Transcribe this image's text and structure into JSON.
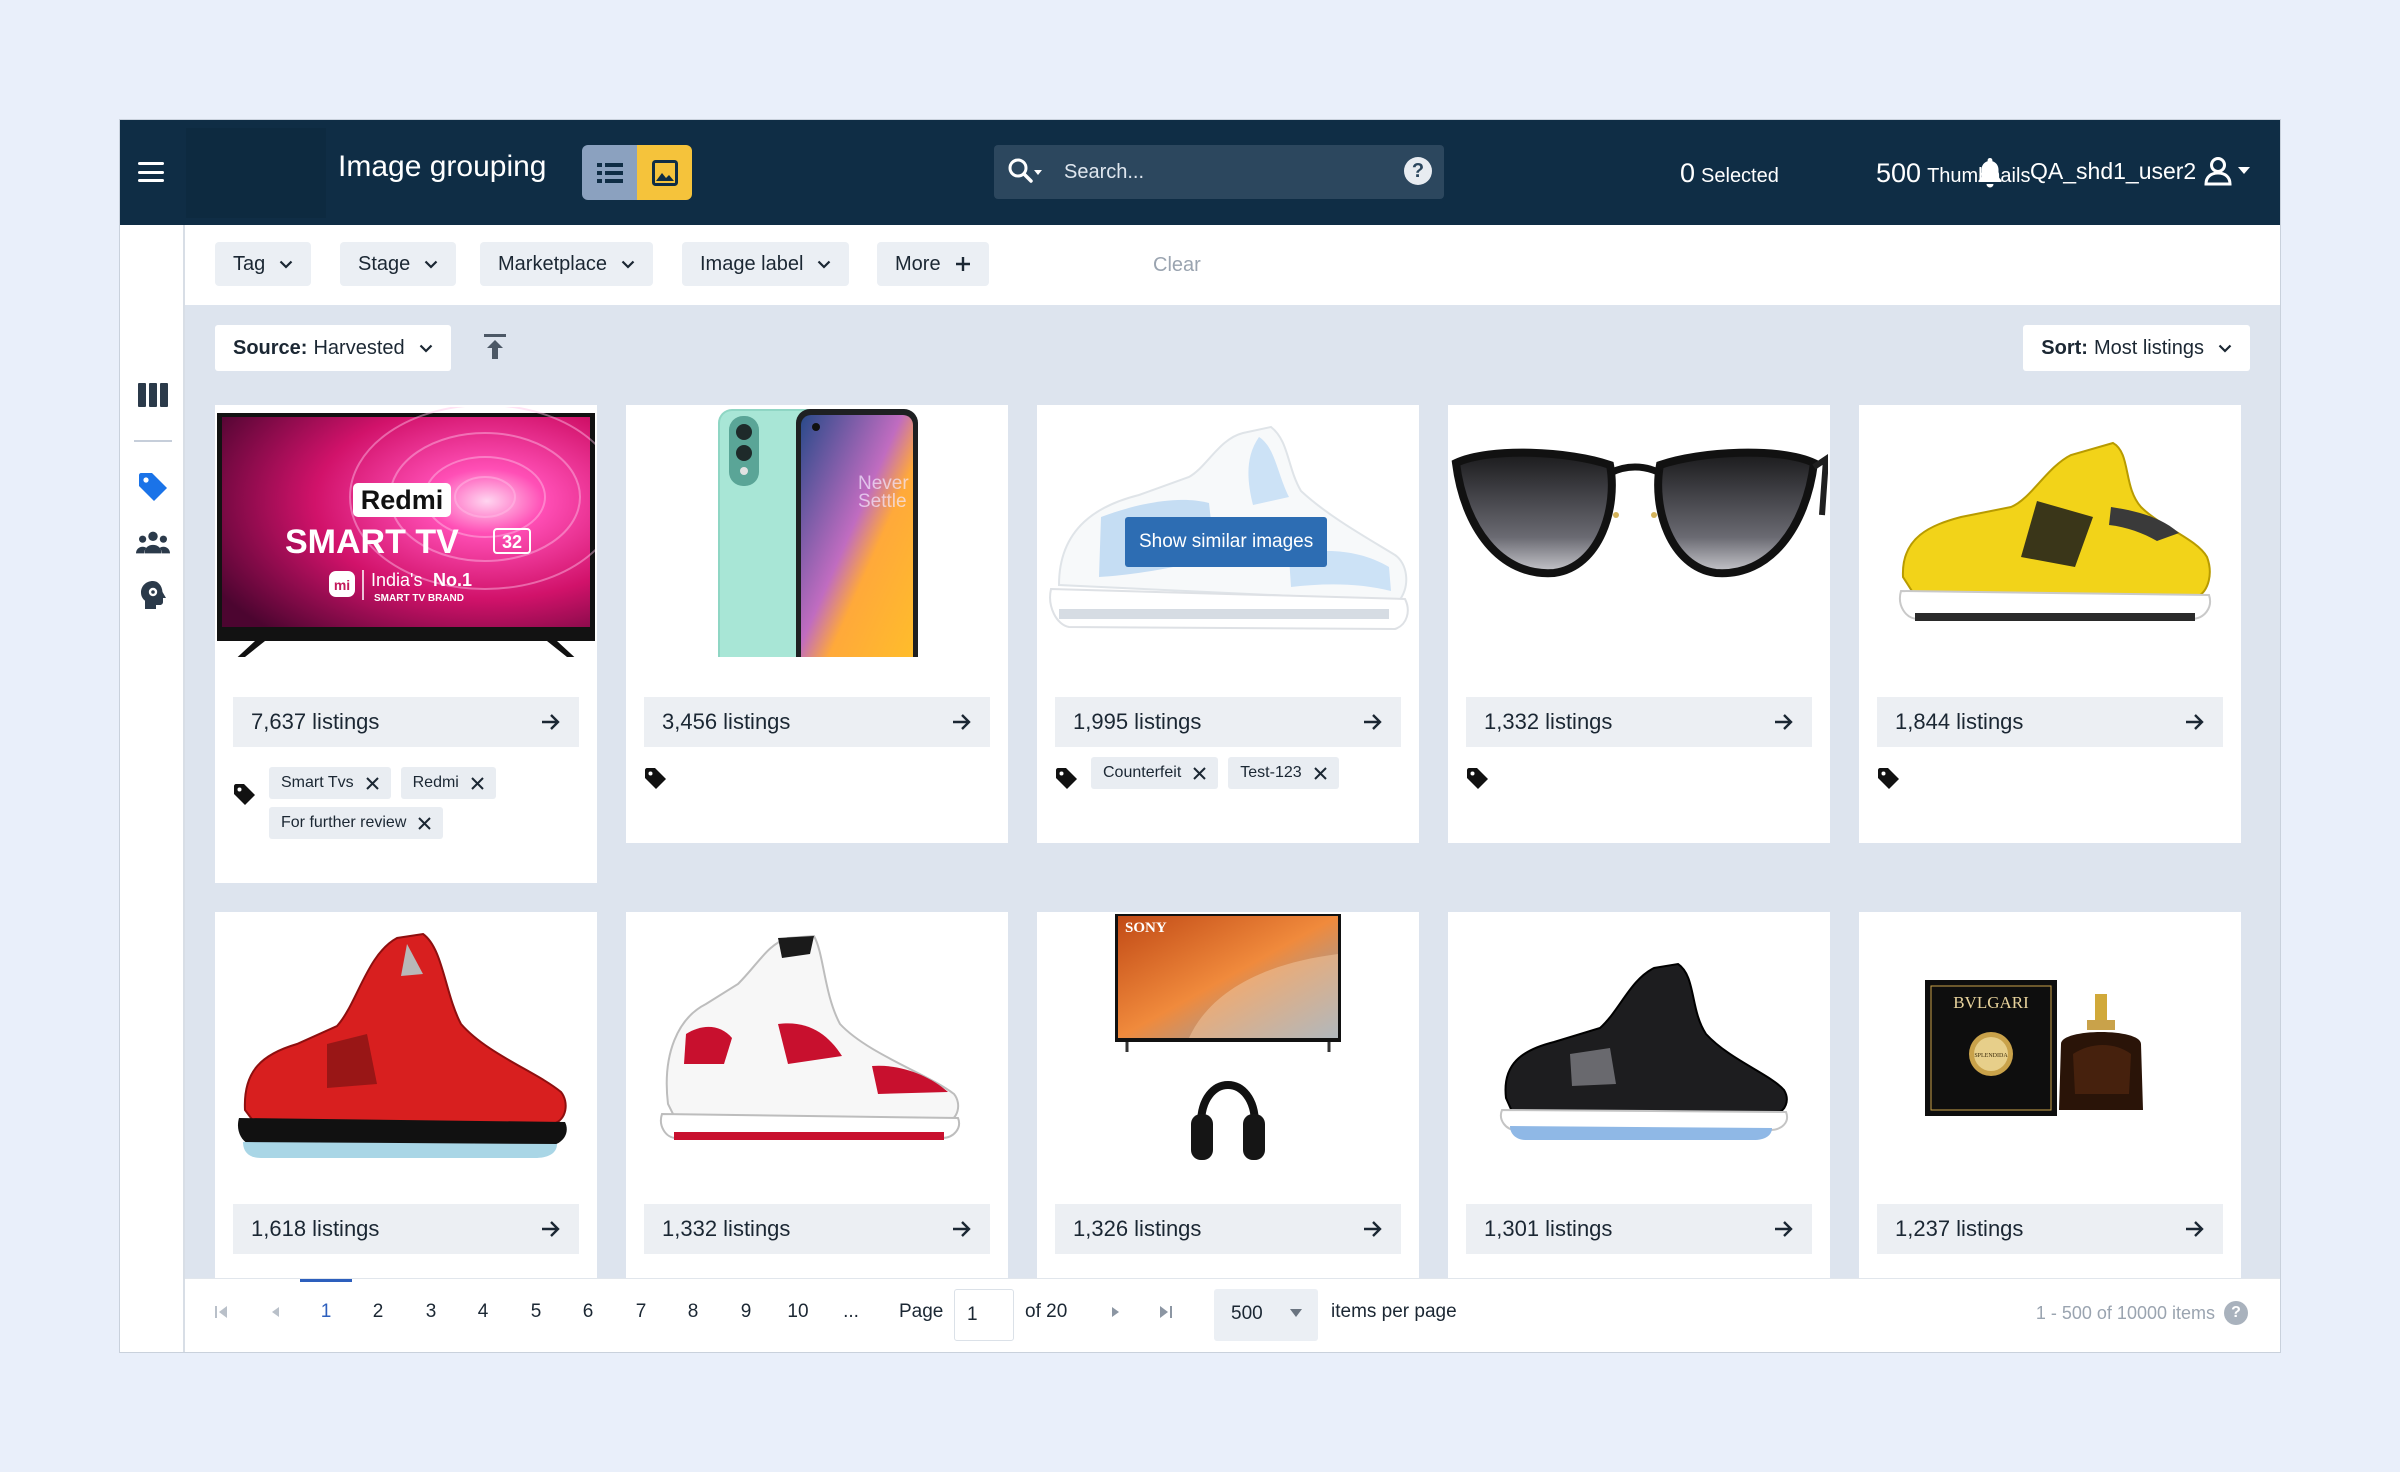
{
  "topbar": {
    "title": "Image grouping",
    "view_modes": [
      "list",
      "grid"
    ],
    "active_view": "grid",
    "search_placeholder": "Search...",
    "selected_count": "0",
    "selected_label": "Selected",
    "thumbnails_count": "500",
    "thumbnails_label": "Thumbnails",
    "username": "QA_shd1_user2"
  },
  "filters": {
    "buttons": [
      "Tag",
      "Stage",
      "Marketplace",
      "Image label",
      "More"
    ],
    "clear_label": "Clear"
  },
  "toolbar": {
    "source_key": "Source:",
    "source_value": "Harvested",
    "sort_key": "Sort:",
    "sort_value": "Most listings"
  },
  "hover_action": "Show similar images",
  "cards": [
    {
      "image": "redmi-smart-tv-32",
      "listings": "7,637 listings",
      "tags": [
        "Smart Tvs",
        "Redmi",
        "For further review"
      ]
    },
    {
      "image": "oneplus-phone",
      "listings": "3,456 listings",
      "tags": []
    },
    {
      "image": "light-blue-sneaker",
      "listings": "1,995 listings",
      "tags": [
        "Counterfeit",
        "Test-123"
      ]
    },
    {
      "image": "black-cat-eye-sunglasses",
      "listings": "1,332 listings",
      "tags": []
    },
    {
      "image": "yellow-sneaker",
      "listings": "1,844 listings",
      "tags": []
    },
    {
      "image": "red-sneaker",
      "listings": "1,618 listings",
      "tags": []
    },
    {
      "image": "white-red-sneaker",
      "listings": "1,332 listings",
      "tags": []
    },
    {
      "image": "sony-tv-and-headphones",
      "listings": "1,326 listings",
      "tags": []
    },
    {
      "image": "black-sneaker",
      "listings": "1,301 listings",
      "tags": []
    },
    {
      "image": "bvlgari-perfume",
      "listings": "1,237 listings",
      "tags": []
    }
  ],
  "image_text": {
    "redmi_brand": "Redmi",
    "redmi_product": "SMART TV",
    "redmi_size": "32",
    "redmi_claim_1": "India's",
    "redmi_claim_2": "No.1",
    "redmi_claim_3": "SMART TV BRAND",
    "mi_logo": "mi",
    "phone_slogan_1": "Never",
    "phone_slogan_2": "Settle",
    "sony_brand": "SONY",
    "perfume_brand": "BVLGARI",
    "perfume_name": "SPLENDIDA"
  },
  "pagination": {
    "pages": [
      "1",
      "2",
      "3",
      "4",
      "5",
      "6",
      "7",
      "8",
      "9",
      "10"
    ],
    "ellipsis": "...",
    "active_page": "1",
    "page_label": "Page",
    "page_value": "1",
    "of_label": "of 20",
    "per_page": "500",
    "per_page_label": "items per page",
    "range_text": "1 - 500 of 10000 items"
  },
  "colors": {
    "topbar_bg": "#0f2d45",
    "accent_yellow": "#f5c33b",
    "accent_blue": "#2d6db3",
    "tag_icon_blue": "#1a73e8",
    "page_bg": "#e9effa",
    "grid_bg": "#dde4ee"
  }
}
